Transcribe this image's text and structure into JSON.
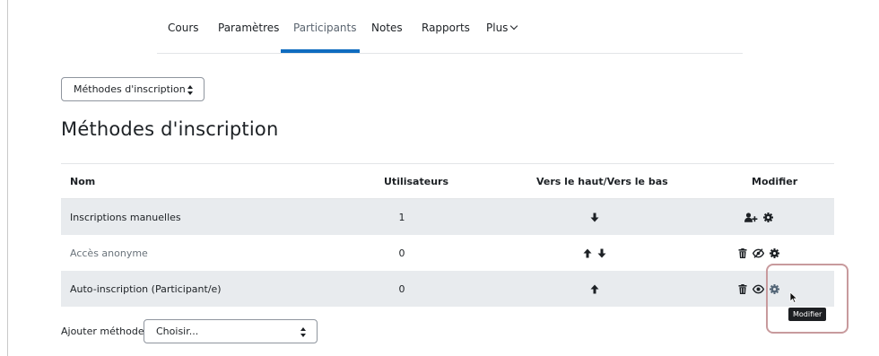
{
  "nav": {
    "items": [
      {
        "label": "Cours"
      },
      {
        "label": "Paramètres"
      },
      {
        "label": "Participants",
        "active": true
      },
      {
        "label": "Notes"
      },
      {
        "label": "Rapports"
      },
      {
        "label": "Plus"
      }
    ]
  },
  "enrol_select": {
    "value": "Méthodes d'inscription"
  },
  "page": {
    "title": "Méthodes d'inscription"
  },
  "table": {
    "headers": {
      "name": "Nom",
      "users": "Utilisateurs",
      "updown": "Vers le haut/Vers le bas",
      "edit": "Modifier"
    },
    "rows": [
      {
        "name": "Inscriptions manuelles",
        "users": "1",
        "updown": [
          "arrow-down-icon"
        ],
        "edit": [
          "enrol-users-icon",
          "cog-icon"
        ],
        "is_link": false
      },
      {
        "name": "Accès anonyme",
        "users": "0",
        "updown": [
          "arrow-up-icon",
          "arrow-down-icon"
        ],
        "edit": [
          "trash-icon",
          "eye-slash-icon",
          "cog-icon"
        ],
        "is_link": true
      },
      {
        "name": "Auto-inscription (Participant/e)",
        "users": "0",
        "updown": [
          "arrow-up-icon"
        ],
        "edit": [
          "trash-icon",
          "eye-icon",
          "cog-icon"
        ],
        "is_link": false
      }
    ]
  },
  "add_method": {
    "label": "Ajouter méthode",
    "select_value": "Choisir..."
  },
  "tooltip": {
    "text": "Modifier"
  },
  "colors": {
    "accent": "#0f6cbf",
    "highlight": "#c89a9d",
    "stripe": "#e8ebee"
  }
}
